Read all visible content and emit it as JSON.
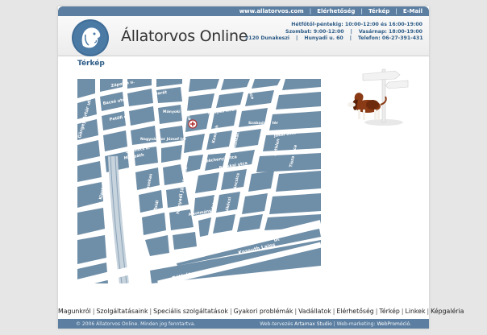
{
  "topnav": {
    "domain": "www.allatorvos.com",
    "links": [
      "Elérhetőség",
      "Térkép",
      "E-Mail"
    ]
  },
  "header": {
    "site_title": "Állatorvos Online",
    "hours_weekday": "Hétfőtől-péntekig: 10:00-12:00 és 16:00-19:00",
    "hours_saturday": "Szombat: 9:00-12:00",
    "hours_sunday": "Vasárnap: 18:00-19:00",
    "address": "2120 Dunakeszi",
    "street": "Hunyadi u. 60",
    "phone": "Telefon: 06-27-391-431"
  },
  "main": {
    "heading": "Térkép"
  },
  "map": {
    "streets": {
      "s1": "Zápolya u.",
      "s2": "Barát",
      "s3": "Bacsó utca",
      "s4": "Mányoki Ádám tér",
      "s5": "utca",
      "s6": "Mátyás király",
      "s7": "utca",
      "s8": "Görgey Artúr utca",
      "s9": "Petőfi u.",
      "s10": "Zrínyi",
      "s11": "Szabadság tér",
      "s12": "Jókai utca",
      "s13": "Nagysándor József tér",
      "s14": "Dugonics u.",
      "s15": "Kossuth",
      "s16": "Munkácsy",
      "s17": "Magyar",
      "s18": "Mikszáth",
      "s19": "Klapka",
      "s20": "Széchenyi utca",
      "s21": "Fazekas",
      "s22": "Tisza utca",
      "s23": "Hunyadi János utca",
      "s24": "Toldi",
      "s25": "Bocskai utca",
      "s26": "Kisfaludy",
      "s27": "Táncsics",
      "s28": "Rákóczi",
      "s29": "Alkotmány u.",
      "s30": "Kossuth Lajos",
      "s31": "út",
      "s32": "Fóti út",
      "s33": "Bethlen"
    }
  },
  "footer": {
    "links": [
      "Magunkról",
      "Szolgáltatásaink",
      "Speciális szolgáltatások",
      "Gyakori problémák",
      "Vadállatok",
      "Elérhetőség",
      "Térkép",
      "Linkek",
      "Képgaléria"
    ],
    "copyright": "© 2006 Állatorvos Online. Minden jog fenntartva.",
    "credit_design_label": "Web-tervezés",
    "credit_design": "Artamax Studio",
    "credit_marketing_label": "Web-marketing:",
    "credit_marketing": "WebPromóció."
  },
  "colors": {
    "brand_blue": "#5b7ea1",
    "map_block": "#6f8ea7",
    "heading_blue": "#2c5b86"
  }
}
